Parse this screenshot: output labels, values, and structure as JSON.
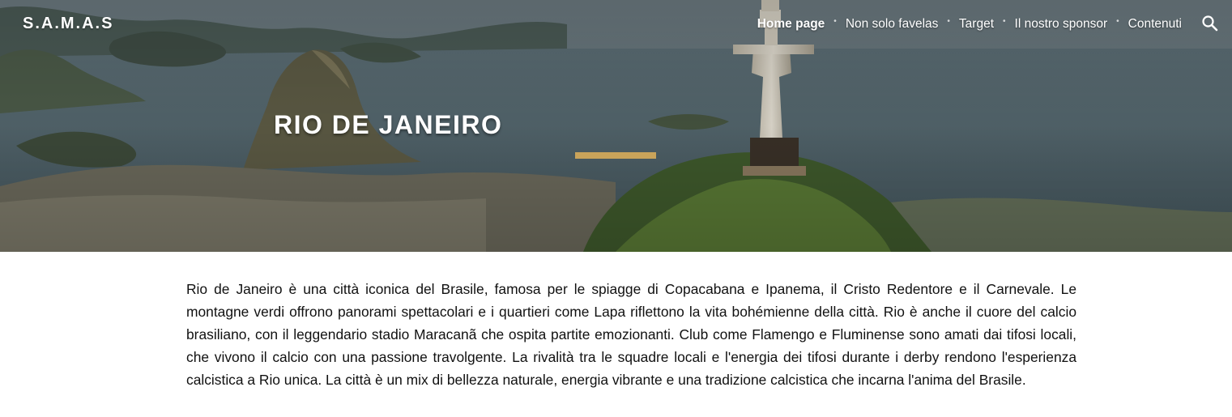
{
  "header": {
    "site_title": "S.A.M.A.S",
    "nav": [
      {
        "label": "Home page",
        "active": true
      },
      {
        "label": "Non solo favelas",
        "active": false
      },
      {
        "label": "Target",
        "active": false
      },
      {
        "label": "Il nostro sponsor",
        "active": false
      },
      {
        "label": "Contenuti",
        "active": false
      }
    ],
    "separator": "•",
    "search_icon": "search-icon"
  },
  "hero": {
    "title": "RIO DE JANEIRO",
    "accent_color": "#c9a35a"
  },
  "content": {
    "paragraph": "Rio de Janeiro è una città iconica del Brasile, famosa per le spiagge di Copacabana e Ipanema, il Cristo Redentore e il Carnevale. Le montagne verdi offrono panorami spettacolari e i quartieri come Lapa riflettono la vita bohémienne della città. Rio è anche il cuore del calcio brasiliano, con il leggendario stadio Maracanã che ospita partite emozionanti. Club come Flamengo e Fluminense sono amati dai tifosi locali, che vivono il calcio con una passione travolgente. La rivalità tra le squadre locali e l'energia dei tifosi durante i derby rendono l'esperienza calcistica a Rio unica. La città è un mix di bellezza naturale, energia vibrante e una tradizione calcistica che incarna l'anima del Brasile."
  }
}
